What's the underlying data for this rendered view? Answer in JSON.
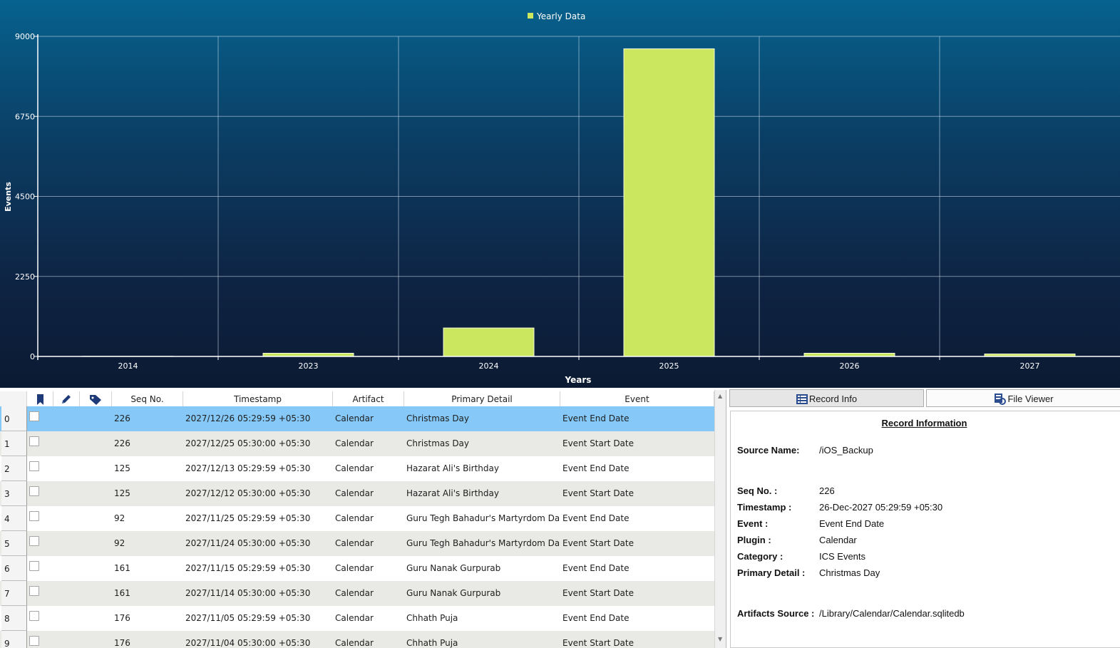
{
  "chart_data": {
    "type": "bar",
    "legend": "Yearly Data",
    "legend_position": "top-center",
    "xlabel": "Years",
    "ylabel": "Events",
    "categories": [
      "2014",
      "2023",
      "2024",
      "2025",
      "2026",
      "2027"
    ],
    "values": [
      5,
      90,
      800,
      8650,
      90,
      70
    ],
    "y_ticks": [
      "9000",
      "6750",
      "4500",
      "2250",
      "0"
    ],
    "ylim": [
      0,
      9000
    ],
    "grid": true,
    "colors": {
      "bar": "#cbe760",
      "background_top": "#06628e",
      "background_bottom": "#0b1a32"
    }
  },
  "grid": {
    "headers": {
      "bookmark_icon": "bookmark-icon",
      "edit_icon": "pencil-icon",
      "tag_icon": "tag-icon",
      "seq": "Seq No.",
      "timestamp": "Timestamp",
      "artifact": "Artifact",
      "primary_detail": "Primary Detail",
      "event": "Event"
    },
    "selected_index": 0,
    "rows": [
      {
        "idx": "0",
        "seq": "226",
        "timestamp": "2027/12/26 05:29:59 +05:30",
        "artifact": "Calendar",
        "primary_detail": "Christmas Day",
        "event": "Event End Date"
      },
      {
        "idx": "1",
        "seq": "226",
        "timestamp": "2027/12/25 05:30:00 +05:30",
        "artifact": "Calendar",
        "primary_detail": "Christmas Day",
        "event": "Event Start Date"
      },
      {
        "idx": "2",
        "seq": "125",
        "timestamp": "2027/12/13 05:29:59 +05:30",
        "artifact": "Calendar",
        "primary_detail": "Hazarat Ali's Birthday",
        "event": "Event End Date"
      },
      {
        "idx": "3",
        "seq": "125",
        "timestamp": "2027/12/12 05:30:00 +05:30",
        "artifact": "Calendar",
        "primary_detail": "Hazarat Ali's Birthday",
        "event": "Event Start Date"
      },
      {
        "idx": "4",
        "seq": "92",
        "timestamp": "2027/11/25 05:29:59 +05:30",
        "artifact": "Calendar",
        "primary_detail": "Guru Tegh Bahadur's Martyrdom Day",
        "event": "Event End Date"
      },
      {
        "idx": "5",
        "seq": "92",
        "timestamp": "2027/11/24 05:30:00 +05:30",
        "artifact": "Calendar",
        "primary_detail": "Guru Tegh Bahadur's Martyrdom Day",
        "event": "Event Start Date"
      },
      {
        "idx": "6",
        "seq": "161",
        "timestamp": "2027/11/15 05:29:59 +05:30",
        "artifact": "Calendar",
        "primary_detail": "Guru Nanak Gurpurab",
        "event": "Event End Date"
      },
      {
        "idx": "7",
        "seq": "161",
        "timestamp": "2027/11/14 05:30:00 +05:30",
        "artifact": "Calendar",
        "primary_detail": "Guru Nanak Gurpurab",
        "event": "Event Start Date"
      },
      {
        "idx": "8",
        "seq": "176",
        "timestamp": "2027/11/05 05:29:59 +05:30",
        "artifact": "Calendar",
        "primary_detail": "Chhath Puja",
        "event": "Event End Date"
      },
      {
        "idx": "9",
        "seq": "176",
        "timestamp": "2027/11/04 05:30:00 +05:30",
        "artifact": "Calendar",
        "primary_detail": "Chhath Puja",
        "event": "Event Start Date"
      }
    ]
  },
  "right_panel": {
    "tabs": {
      "record_info": "Record Info",
      "record_info_icon": "list-icon",
      "file_viewer": "File Viewer",
      "file_viewer_icon": "file-viewer-icon"
    },
    "record": {
      "title": "Record Information ",
      "source_name_label": "Source Name:",
      "source_name": "/iOS_Backup",
      "seq_label": "Seq No. :",
      "seq": "226",
      "timestamp_label": "Timestamp :",
      "timestamp": "26-Dec-2027 05:29:59 +05:30",
      "event_label": "Event :",
      "event": "Event End Date",
      "plugin_label": "Plugin :",
      "plugin": "Calendar",
      "category_label": "Category :",
      "category": "ICS Events",
      "primary_detail_label": "Primary Detail :",
      "primary_detail": "Christmas Day",
      "artifacts_source_label": "Artifacts Source :",
      "artifacts_source": "/Library/Calendar/Calendar.sqlitedb"
    }
  }
}
